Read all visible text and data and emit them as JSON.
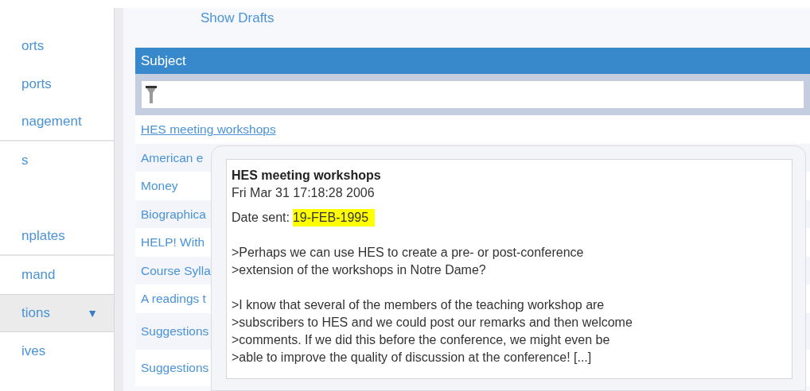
{
  "sidebar": {
    "items": [
      {
        "label": "orts",
        "selected": false,
        "divider_after": false
      },
      {
        "label": "ports",
        "selected": false,
        "divider_after": false
      },
      {
        "label": "nagement",
        "selected": false,
        "divider_after": true
      },
      {
        "label": "s",
        "selected": false,
        "divider_after": false
      },
      {
        "label": "nplates",
        "selected": false,
        "divider_after": true,
        "gap_before": true
      },
      {
        "label": "mand",
        "selected": false,
        "divider_after": false
      },
      {
        "label": "tions",
        "selected": true,
        "divider_after": false,
        "caret": "▼"
      },
      {
        "label": "ives",
        "selected": false,
        "divider_after": false
      }
    ]
  },
  "show_drafts": "Show Drafts",
  "table": {
    "columns": [
      "Subject"
    ],
    "rows": [
      {
        "subject": "HES meeting workshops",
        "hovered": true,
        "tall": false
      },
      {
        "subject": "American e",
        "hovered": false,
        "tall": false
      },
      {
        "subject": "Money",
        "hovered": false,
        "tall": false
      },
      {
        "subject": "Biographica",
        "hovered": false,
        "tall": false
      },
      {
        "subject": "HELP! With",
        "hovered": false,
        "tall": false
      },
      {
        "subject": "Course Sylla",
        "hovered": false,
        "tall": false
      },
      {
        "subject": "A readings t",
        "hovered": false,
        "tall": false
      },
      {
        "subject": "Suggestions",
        "hovered": false,
        "tall": true
      },
      {
        "subject": "Suggestions",
        "hovered": false,
        "tall": true
      }
    ]
  },
  "tooltip": {
    "title": "HES meeting workshops",
    "timestamp": "Fri Mar 31 17:18:28 2006",
    "date_label": "Date sent:",
    "date_value": "19-FEB-1995",
    "paragraphs": [
      [
        ">Perhaps we can use HES to create a pre- or post-conference",
        ">extension of the workshops in Notre Dame?"
      ],
      [
        ">I know that several of the members of the teaching workshop are",
        ">subscribers to HES and we could post our remarks and then welcome",
        ">comments. If we did this before the conference, we might even be",
        ">able to improve the quality of discussion at the conference! [...]"
      ]
    ]
  }
}
